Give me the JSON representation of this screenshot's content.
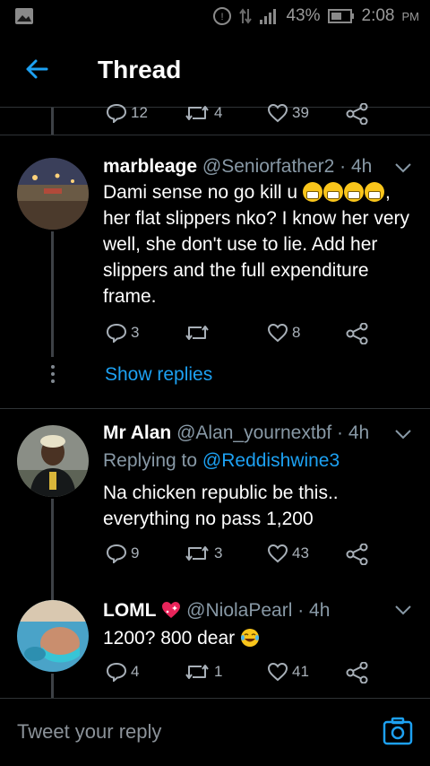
{
  "status_bar": {
    "battery": "43%",
    "time": "2:08",
    "ampm": "PM"
  },
  "header": {
    "title": "Thread"
  },
  "top_actions": {
    "replies": "12",
    "retweets": "4",
    "likes": "39"
  },
  "tweets": [
    {
      "name": "marbleage",
      "handle": "@Seniorfather2",
      "time": "· 4h",
      "text_part1": "Dami sense no go kill u ",
      "text_part2": ", her flat slippers nko? I know her very well, she don't use to lie. Add her slippers and the full expenditure frame.",
      "emoji": "grinning-face-with-smiling-eyes",
      "replies": "3",
      "retweets": "",
      "likes": "8",
      "show_replies": "Show replies"
    },
    {
      "name": "Mr Alan",
      "handle": "@Alan_yournextbf",
      "time": "· 4h",
      "replying_label": "Replying to",
      "replying_handle": "@Reddishwine3",
      "text": "Na chicken republic be this.. everything no pass 1,200",
      "replies": "9",
      "retweets": "3",
      "likes": "43"
    },
    {
      "name": "LOML",
      "handle": "@NiolaPearl",
      "time": "· 4h",
      "name_emoji": "sparkling-heart",
      "text": "1200? 800 dear ",
      "emoji": "face-with-tears-of-joy",
      "replies": "4",
      "retweets": "1",
      "likes": "41"
    }
  ],
  "composer": {
    "placeholder": "Tweet your reply"
  },
  "colors": {
    "background": "#000000",
    "accent": "#1da1f2",
    "muted": "#8899a6",
    "divider": "#2f3336"
  }
}
